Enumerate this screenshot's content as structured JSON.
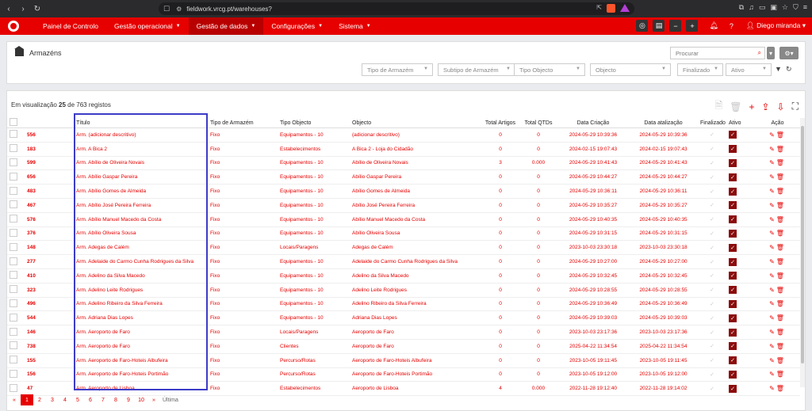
{
  "browser": {
    "url": "fieldwork.vrcg.pt/warehouses?"
  },
  "nav": {
    "items": [
      {
        "label": "Painel de Controlo",
        "caret": ""
      },
      {
        "label": "Gestão operacional",
        "caret": "▼"
      },
      {
        "label": "Gestão de dados",
        "caret": "▼"
      },
      {
        "label": "Configurações",
        "caret": "▼"
      },
      {
        "label": "Sistema",
        "caret": "▼"
      }
    ],
    "active_index": 2,
    "user": "Diego miranda ▾"
  },
  "header": {
    "title": "Armazéns",
    "search_placeholder": "Procurar",
    "filters": [
      "Tipo de Armazém",
      "Subtipo de Armazém",
      "Tipo Objecto",
      "Objecto",
      "Finalizado",
      "Ativo"
    ]
  },
  "list": {
    "count_prefix": "Em visualização ",
    "count_shown": "25",
    "count_mid": " de ",
    "count_total": "763",
    "count_suffix": " registos"
  },
  "table": {
    "headers": [
      "Título",
      "Tipo de Armazém",
      "Tipo Objecto",
      "Objecto",
      "Total Artigos",
      "Total QTDs",
      "Data Criação",
      "Data atalização",
      "Finalizado",
      "Ativo",
      "Ação"
    ],
    "rows": [
      {
        "id": "556",
        "titulo": "Arm. (adicionar descritivo)",
        "tipo": "Fixo",
        "tipo_obj": "Equipamentos - 10",
        "objecto": "(adicionar descritivo)",
        "artigos": "0",
        "qtds": "0",
        "criacao": "2024-05-29 10:39:36",
        "atualizacao": "2024-05-29 10:39:36"
      },
      {
        "id": "183",
        "titulo": "Arm. A Bica 2",
        "tipo": "Fixo",
        "tipo_obj": "Estabelecimentos",
        "objecto": "A Bica 2 - Loja do Cidadão",
        "artigos": "0",
        "qtds": "0",
        "criacao": "2024-02-15 19:07:43",
        "atualizacao": "2024-02-15 19:07:43"
      },
      {
        "id": "599",
        "titulo": "Arm. Abílio de Oliveira Novais",
        "tipo": "Fixo",
        "tipo_obj": "Equipamentos - 10",
        "objecto": "Abílio de Oliveira Novais",
        "artigos": "3",
        "qtds": "0.000",
        "criacao": "2024-05-29 10:41:43",
        "atualizacao": "2024-05-29 10:41:43"
      },
      {
        "id": "656",
        "titulo": "Arm. Abílio Gaspar Pereira",
        "tipo": "Fixo",
        "tipo_obj": "Equipamentos - 10",
        "objecto": "Abílio Gaspar Pereira",
        "artigos": "0",
        "qtds": "0",
        "criacao": "2024-05-29 10:44:27",
        "atualizacao": "2024-05-29 10:44:27"
      },
      {
        "id": "483",
        "titulo": "Arm. Abílio Gomes de Almeida",
        "tipo": "Fixo",
        "tipo_obj": "Equipamentos - 10",
        "objecto": "Abílio Gomes de Almeida",
        "artigos": "0",
        "qtds": "0",
        "criacao": "2024-05-29 10:36:11",
        "atualizacao": "2024-05-29 10:36:11"
      },
      {
        "id": "467",
        "titulo": "Arm. Abílio José Pereira Ferreira",
        "tipo": "Fixo",
        "tipo_obj": "Equipamentos - 10",
        "objecto": "Abílio José Pereira Ferreira",
        "artigos": "0",
        "qtds": "0",
        "criacao": "2024-05-29 10:35:27",
        "atualizacao": "2024-05-29 10:35:27"
      },
      {
        "id": "576",
        "titulo": "Arm. Abílio Manuel Macedo da Costa",
        "tipo": "Fixo",
        "tipo_obj": "Equipamentos - 10",
        "objecto": "Abílio Manuel Macedo da Costa",
        "artigos": "0",
        "qtds": "0",
        "criacao": "2024-05-29 10:40:35",
        "atualizacao": "2024-05-29 10:40:35"
      },
      {
        "id": "376",
        "titulo": "Arm. Abílio Oliveira Sousa",
        "tipo": "Fixo",
        "tipo_obj": "Equipamentos - 10",
        "objecto": "Abílio Oliveira Sousa",
        "artigos": "0",
        "qtds": "0",
        "criacao": "2024-05-29 10:31:15",
        "atualizacao": "2024-05-29 10:31:15"
      },
      {
        "id": "148",
        "titulo": "Arm. Adegas de Calém",
        "tipo": "Fixo",
        "tipo_obj": "Locais/Paragens",
        "objecto": "Adegas de Calém",
        "artigos": "0",
        "qtds": "0",
        "criacao": "2023-10-03 23:30:18",
        "atualizacao": "2023-10-03 23:30:18"
      },
      {
        "id": "277",
        "titulo": "Arm. Adelaide do Carmo Cunha Rodrigues da Silva",
        "tipo": "Fixo",
        "tipo_obj": "Equipamentos - 10",
        "objecto": "Adelaide do Carmo Cunha Rodrigues da Silva",
        "artigos": "0",
        "qtds": "0",
        "criacao": "2024-05-29 10:27:00",
        "atualizacao": "2024-05-29 10:27:00"
      },
      {
        "id": "410",
        "titulo": "Arm. Adelino da Silva Macedo",
        "tipo": "Fixo",
        "tipo_obj": "Equipamentos - 10",
        "objecto": "Adelino da Silva Macedo",
        "artigos": "0",
        "qtds": "0",
        "criacao": "2024-05-29 10:32:45",
        "atualizacao": "2024-05-29 10:32:45"
      },
      {
        "id": "323",
        "titulo": "Arm. Adelino Leite Rodrigues",
        "tipo": "Fixo",
        "tipo_obj": "Equipamentos - 10",
        "objecto": "Adelino Leite Rodrigues",
        "artigos": "0",
        "qtds": "0",
        "criacao": "2024-05-29 10:28:55",
        "atualizacao": "2024-05-29 10:28:55"
      },
      {
        "id": "496",
        "titulo": "Arm. Adelino Ribeiro da Silva Ferreira",
        "tipo": "Fixo",
        "tipo_obj": "Equipamentos - 10",
        "objecto": "Adelino Ribeiro da Silva Ferreira",
        "artigos": "0",
        "qtds": "0",
        "criacao": "2024-05-29 10:36:49",
        "atualizacao": "2024-05-29 10:36:49"
      },
      {
        "id": "544",
        "titulo": "Arm. Adriana Dias Lopes",
        "tipo": "Fixo",
        "tipo_obj": "Equipamentos - 10",
        "objecto": "Adriana Dias Lopes",
        "artigos": "0",
        "qtds": "0",
        "criacao": "2024-05-29 10:39:03",
        "atualizacao": "2024-05-29 10:39:03"
      },
      {
        "id": "146",
        "titulo": "Arm. Aeroporto de Faro",
        "tipo": "Fixo",
        "tipo_obj": "Locais/Paragens",
        "objecto": "Aeroporto de Faro",
        "artigos": "0",
        "qtds": "0",
        "criacao": "2023-10-03 23:17:36",
        "atualizacao": "2023-10-03 23:17:36"
      },
      {
        "id": "738",
        "titulo": "Arm. Aeroporto de Faro",
        "tipo": "Fixo",
        "tipo_obj": "Clientes",
        "objecto": "Aeroporto de Faro",
        "artigos": "0",
        "qtds": "0",
        "criacao": "2025-04-22 11:34:54",
        "atualizacao": "2025-04-22 11:34:54"
      },
      {
        "id": "155",
        "titulo": "Arm. Aeroporto de Faro-Hoteis Albufeira",
        "tipo": "Fixo",
        "tipo_obj": "Percurso/Rotas",
        "objecto": "Aeroporto de Faro-Hoteis Albufeira",
        "artigos": "0",
        "qtds": "0",
        "criacao": "2023-10-05 19:11:45",
        "atualizacao": "2023-10-05 19:11:45"
      },
      {
        "id": "156",
        "titulo": "Arm. Aeroporto de Faro-Hoteis Portimão",
        "tipo": "Fixo",
        "tipo_obj": "Percurso/Rotas",
        "objecto": "Aeroporto de Faro-Hoteis Portimão",
        "artigos": "0",
        "qtds": "0",
        "criacao": "2023-10-05 19:12:00",
        "atualizacao": "2023-10-05 19:12:00"
      },
      {
        "id": "47",
        "titulo": "Arm. Aeroporto de Lisboa",
        "tipo": "Fixo",
        "tipo_obj": "Estabelecimentos",
        "objecto": "Aeroporto de Lisboa",
        "artigos": "4",
        "qtds": "0.000",
        "criacao": "2022-11-28 19:12:40",
        "atualizacao": "2022-11-28 19:14:02"
      }
    ]
  },
  "pagination": {
    "prev": "«",
    "pages": [
      "1",
      "2",
      "3",
      "4",
      "5",
      "6",
      "7",
      "8",
      "9",
      "10"
    ],
    "active": "1",
    "next": "»",
    "last": "Última"
  },
  "colors": {
    "brand": "#e60000",
    "highlight": "#3c3cc8"
  }
}
